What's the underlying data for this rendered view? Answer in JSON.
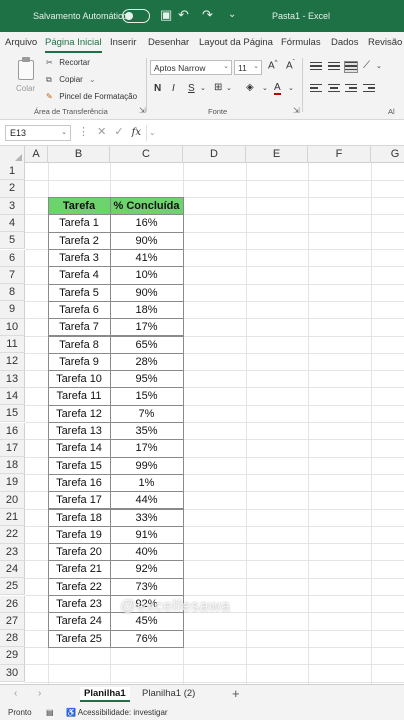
{
  "titlebar": {
    "autosave_label": "Salvamento Automático",
    "file_title": "Pasta1 - Excel"
  },
  "ribbon_tabs": [
    "Arquivo",
    "Página Inicial",
    "Inserir",
    "Desenhar",
    "Layout da Página",
    "Fórmulas",
    "Dados",
    "Revisão"
  ],
  "ribbon": {
    "paste_label": "Colar",
    "cut_label": "Recortar",
    "copy_label": "Copiar",
    "format_painter_label": "Pincel de Formatação",
    "clipboard_group": "Área de Transferência",
    "font_name": "Aptos Narrow",
    "font_size": "11",
    "font_group": "Fonte",
    "align_group_partial": "Al"
  },
  "formula_bar": {
    "name_box": "E13",
    "fx_label": "fx",
    "formula": ""
  },
  "grid": {
    "columns": [
      "A",
      "B",
      "C",
      "D",
      "E",
      "F",
      "G"
    ],
    "rows": [
      "1",
      "2",
      "3",
      "4",
      "5",
      "6",
      "7",
      "8",
      "9",
      "10",
      "11",
      "12",
      "13",
      "14",
      "15",
      "16",
      "17",
      "18",
      "19",
      "20",
      "21",
      "22",
      "23",
      "24",
      "25",
      "26",
      "27",
      "28",
      "29",
      "30"
    ],
    "table_header": [
      "Tarefa",
      "% Concluída"
    ],
    "table_rows": [
      [
        "Tarefa 1",
        "16%"
      ],
      [
        "Tarefa 2",
        "90%"
      ],
      [
        "Tarefa 3",
        "41%"
      ],
      [
        "Tarefa 4",
        "10%"
      ],
      [
        "Tarefa 5",
        "90%"
      ],
      [
        "Tarefa 6",
        "18%"
      ],
      [
        "Tarefa 7",
        "17%"
      ],
      [
        "Tarefa 8",
        "65%"
      ],
      [
        "Tarefa 9",
        "28%"
      ],
      [
        "Tarefa 10",
        "95%"
      ],
      [
        "Tarefa 11",
        "15%"
      ],
      [
        "Tarefa 12",
        "7%"
      ],
      [
        "Tarefa 13",
        "35%"
      ],
      [
        "Tarefa 14",
        "17%"
      ],
      [
        "Tarefa 15",
        "99%"
      ],
      [
        "Tarefa 16",
        "1%"
      ],
      [
        "Tarefa 17",
        "44%"
      ],
      [
        "Tarefa 18",
        "33%"
      ],
      [
        "Tarefa 19",
        "91%"
      ],
      [
        "Tarefa 20",
        "40%"
      ],
      [
        "Tarefa 21",
        "92%"
      ],
      [
        "Tarefa 22",
        "73%"
      ],
      [
        "Tarefa 23",
        "92%"
      ],
      [
        "Tarefa 24",
        "45%"
      ],
      [
        "Tarefa 25",
        "76%"
      ]
    ],
    "header_fill_color": "#6dd36d"
  },
  "watermark": "@excelfesawa",
  "sheet_tabs": [
    "Planilha1",
    "Planilha1 (2)"
  ],
  "statusbar": {
    "ready": "Pronto",
    "accessibility": "Acessibilidade: investigar"
  },
  "colors": {
    "brand": "#1e7145",
    "ribbon_bg": "#f3f3f3"
  }
}
